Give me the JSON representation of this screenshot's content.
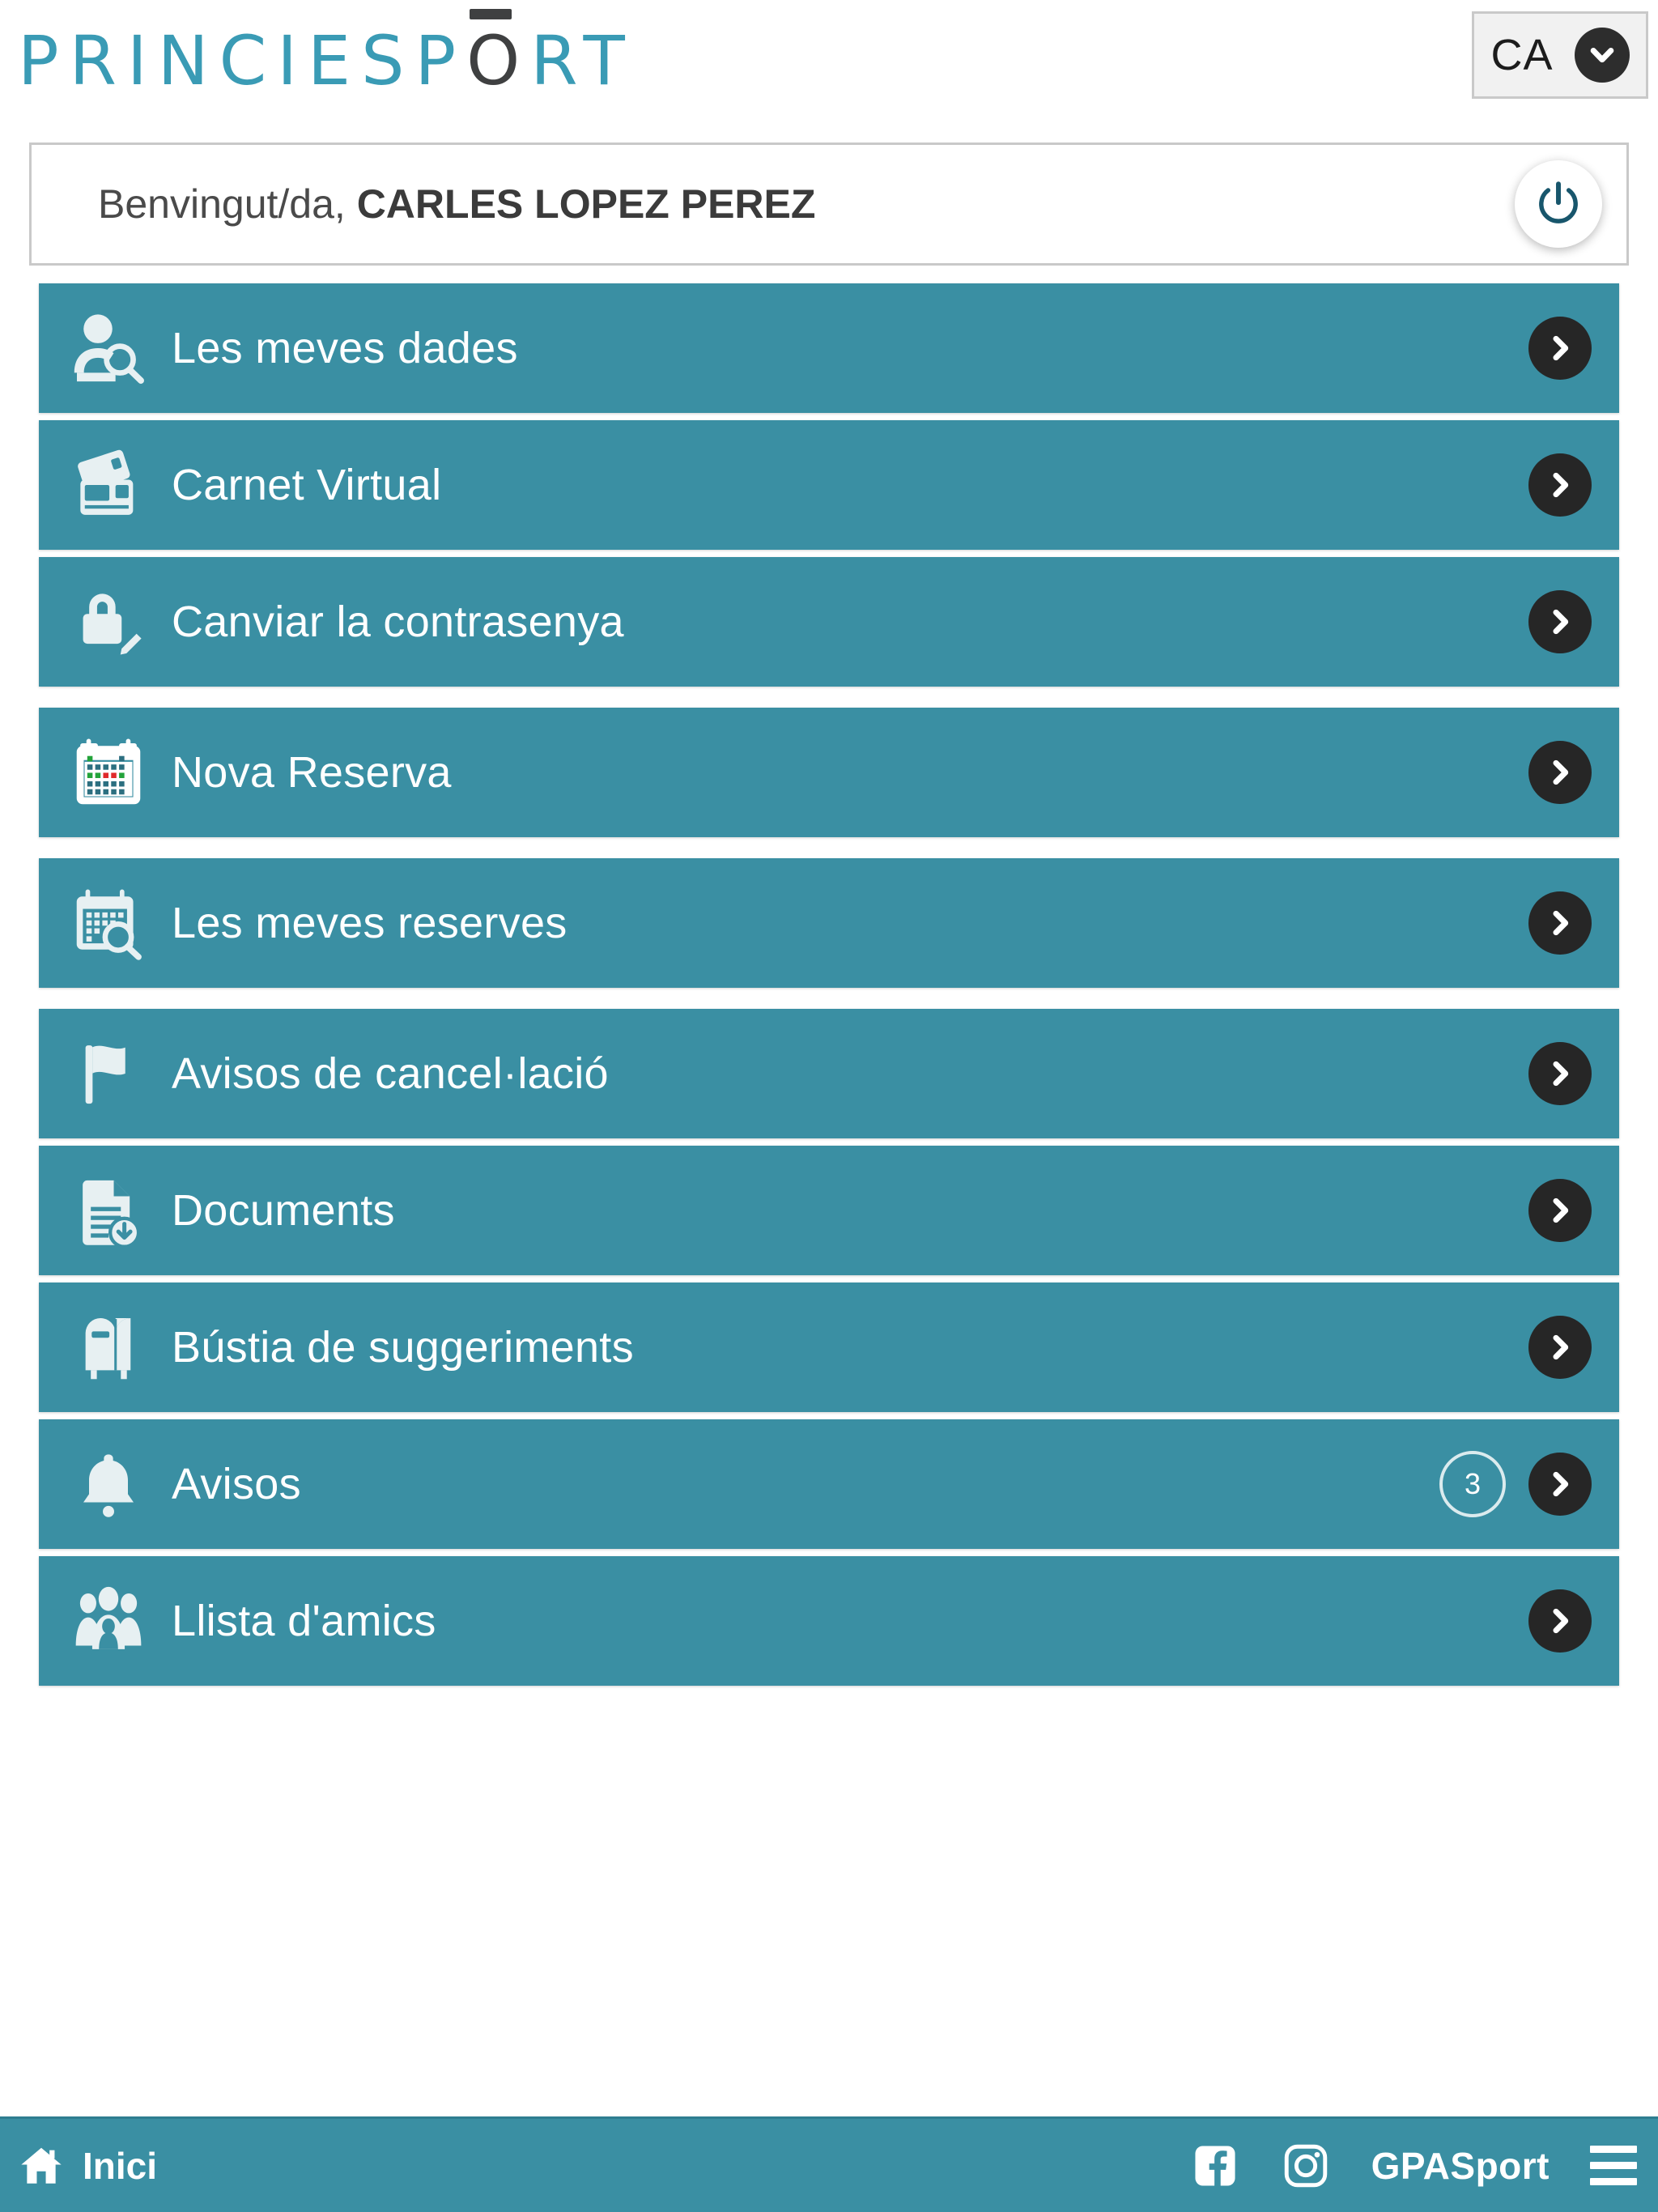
{
  "header": {
    "logo_text_1": "PRINCIESP",
    "logo_text_o": "O",
    "logo_text_2": "RT",
    "logo_full": "PRINCIESPŌRT",
    "language": {
      "code": "CA",
      "chevron_icon": "chevron-down-icon"
    },
    "colors": {
      "logo_teal": "#3a9bb5",
      "logo_dark": "#3f4041"
    }
  },
  "welcome": {
    "greeting": "Benvingut/da,",
    "user_name": "CARLES LOPEZ PEREZ",
    "logout_icon": "power-icon"
  },
  "menu": {
    "groups": [
      {
        "items": [
          {
            "label": "Les meves dades",
            "icon": "user-search-icon",
            "badge": null,
            "chevron_icon": "chevron-right-icon"
          },
          {
            "label": "Carnet Virtual",
            "icon": "id-cards-icon",
            "badge": null,
            "chevron_icon": "chevron-right-icon"
          },
          {
            "label": "Canviar la contrasenya",
            "icon": "lock-pencil-icon",
            "badge": null,
            "chevron_icon": "chevron-right-icon"
          }
        ]
      },
      {
        "items": [
          {
            "label": "Nova Reserva",
            "icon": "calendar-color-icon",
            "badge": null,
            "chevron_icon": "chevron-right-icon"
          }
        ]
      },
      {
        "items": [
          {
            "label": "Les meves reserves",
            "icon": "calendar-search-icon",
            "badge": null,
            "chevron_icon": "chevron-right-icon"
          }
        ]
      },
      {
        "items": [
          {
            "label": "Avisos de cancel·lació",
            "icon": "flag-icon",
            "badge": null,
            "chevron_icon": "chevron-right-icon"
          },
          {
            "label": "Documents",
            "icon": "document-download-icon",
            "badge": null,
            "chevron_icon": "chevron-right-icon"
          },
          {
            "label": "Bústia de suggeriments",
            "icon": "mailbox-icon",
            "badge": null,
            "chevron_icon": "chevron-right-icon"
          },
          {
            "label": "Avisos",
            "icon": "bell-icon",
            "badge": "3",
            "chevron_icon": "chevron-right-icon"
          },
          {
            "label": "Llista d'amics",
            "icon": "people-group-icon",
            "badge": null,
            "chevron_icon": "chevron-right-icon"
          }
        ]
      }
    ],
    "colors": {
      "item_background": "#3a8fa3",
      "item_text": "#ffffff",
      "chevron_circle": "#262626"
    }
  },
  "footer": {
    "home_label": "Inici",
    "home_icon": "home-icon",
    "facebook_icon": "facebook-icon",
    "instagram_icon": "instagram-icon",
    "brand": "GPASport",
    "menu_icon": "hamburger-icon",
    "background": "#3a8fa3"
  }
}
